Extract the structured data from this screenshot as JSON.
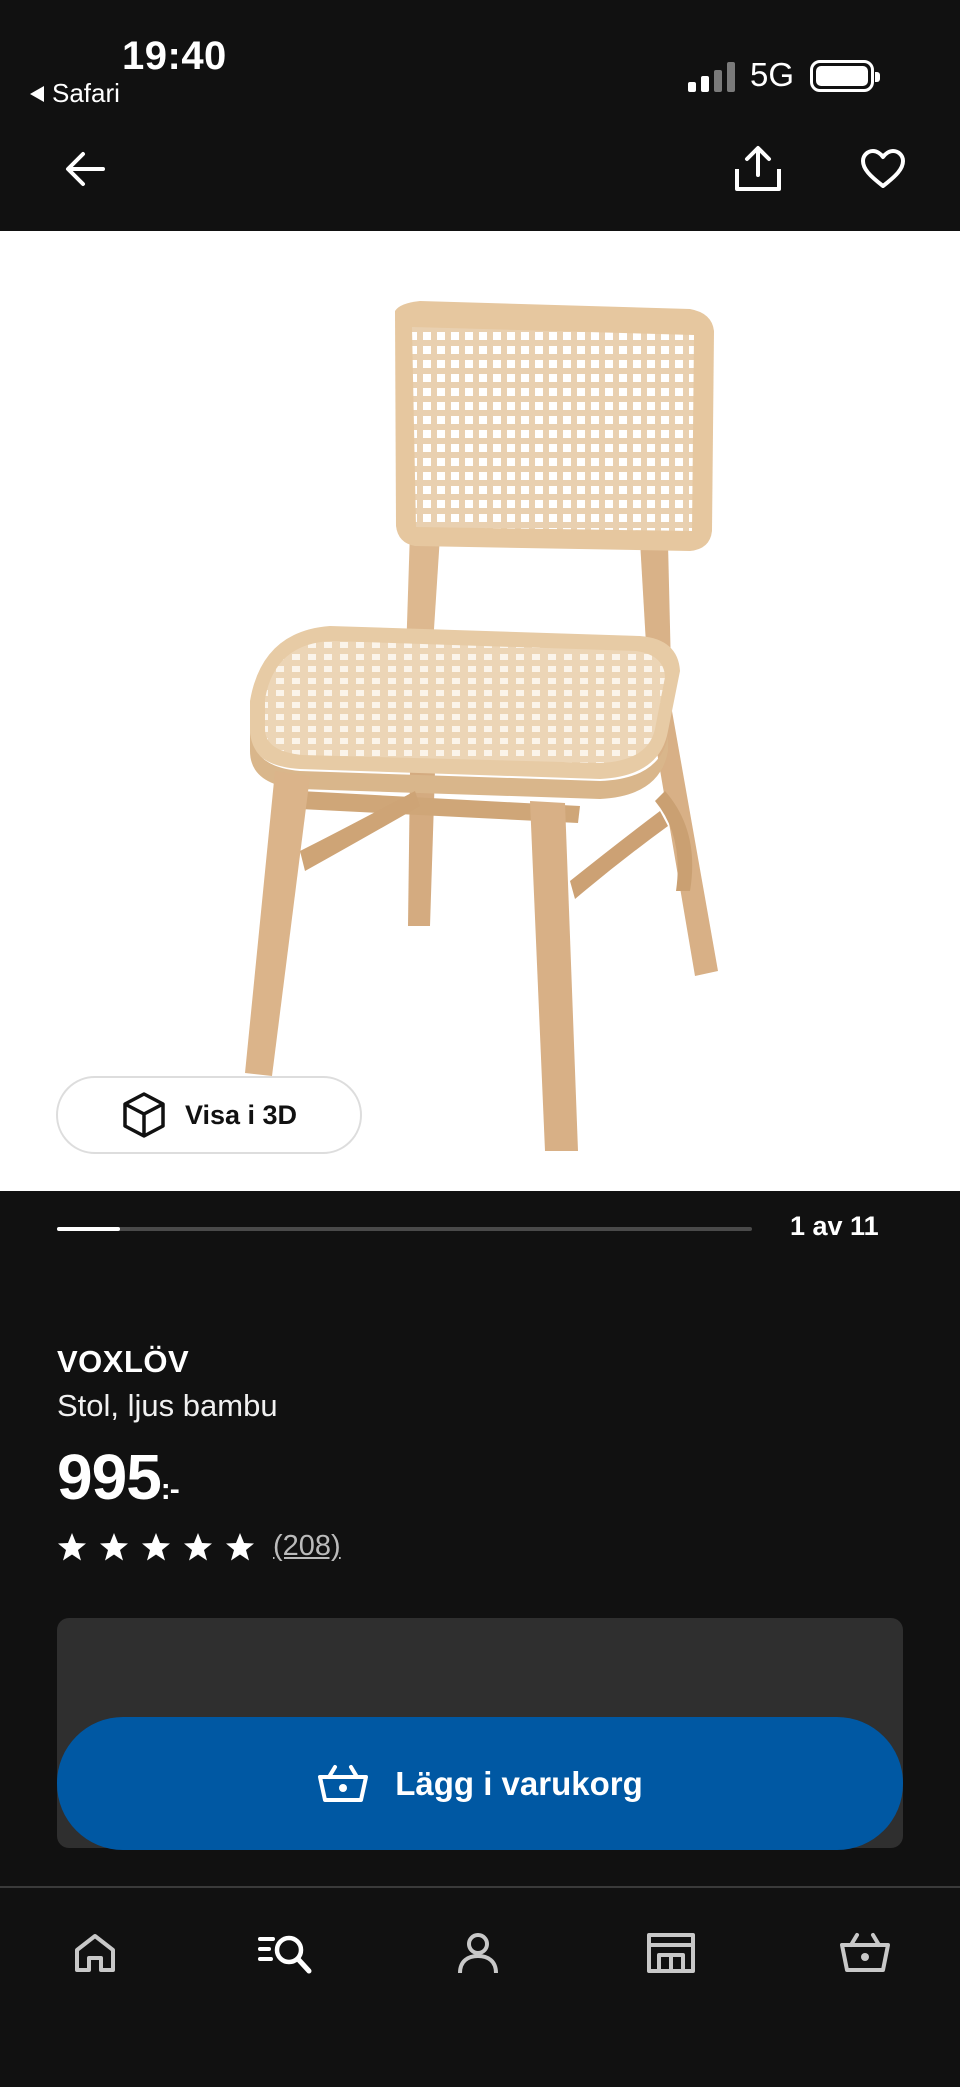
{
  "status_bar": {
    "time": "19:40",
    "back_app": "Safari",
    "network": "5G"
  },
  "top_nav": {
    "back_icon": "arrow-left-icon",
    "share_icon": "share-icon",
    "favorite_icon": "heart-icon"
  },
  "image_viewer": {
    "view_3d_label": "Visa i 3D",
    "view_3d_icon": "cube-icon",
    "counter": "1 av 11",
    "current_index": 1,
    "total": 11
  },
  "product": {
    "name": "VOXLÖV",
    "description": "Stol, ljus bambu",
    "price": "995",
    "price_suffix": ":-",
    "rating_stars": 5,
    "review_count": "(208)"
  },
  "cta": {
    "label": "Lägg i varukorg",
    "icon": "basket-icon",
    "color": "#0058a3"
  },
  "tab_bar": {
    "tabs": [
      {
        "icon": "home-icon"
      },
      {
        "icon": "search-list-icon"
      },
      {
        "icon": "profile-icon"
      },
      {
        "icon": "store-icon"
      },
      {
        "icon": "cart-icon"
      }
    ]
  }
}
